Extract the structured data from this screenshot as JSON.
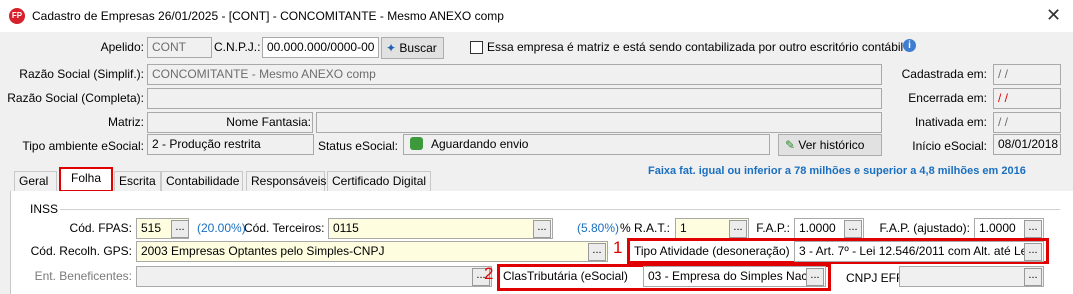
{
  "window": {
    "title": "Cadastro de Empresas  26/01/2025 - [CONT] - CONCOMITANTE - Mesmo ANEXO comp",
    "app_icon_text": "FP",
    "close_glyph": "✕"
  },
  "header": {
    "apelido_label": "Apelido:",
    "apelido_value": "CONT",
    "cnpj_label": "C.N.P.J.:",
    "cnpj_value": "00.000.000/0000-00",
    "buscar_label": "Buscar",
    "matriz_checkbox_label": "Essa empresa é matriz e está sendo contabilizada por outro escritório contábil",
    "razao_simplif_label": "Razão Social (Simplif.):",
    "razao_simplif_value": "CONCOMITANTE - Mesmo ANEXO comp",
    "razao_completa_label": "Razão Social (Completa):",
    "razao_completa_value": "",
    "matriz_label": "Matriz:",
    "matriz_value": "",
    "nome_fantasia_label": "Nome Fantasia:",
    "nome_fantasia_value": "",
    "tipo_ambiente_label": "Tipo ambiente eSocial:",
    "tipo_ambiente_value": "2 - Produção restrita",
    "status_esocial_label": "Status eSocial:",
    "status_esocial_value": "Aguardando envio",
    "ver_historico_label": "Ver histórico",
    "cadastrada_label": "Cadastrada em:",
    "cadastrada_value": "/ /",
    "encerrada_label": "Encerrada em:",
    "encerrada_value": "/ /",
    "inativada_label": "Inativada em:",
    "inativada_value": "/ /",
    "inicio_esocial_label": "Início eSocial:",
    "inicio_esocial_value": "08/01/2018"
  },
  "tabs": [
    {
      "label": "Geral",
      "active": false
    },
    {
      "label": "Folha",
      "active": true
    },
    {
      "label": "Escrita",
      "active": false
    },
    {
      "label": "Contabilidade",
      "active": false
    },
    {
      "label": "Responsáveis",
      "active": false
    },
    {
      "label": "Certificado Digital",
      "active": false
    }
  ],
  "faixa_text": "Faixa fat. igual ou inferior a 78 milhões e superior a 4,8 milhões em 2016",
  "inss": {
    "group_label": "INSS",
    "cod_fpas_label": "Cód. FPAS:",
    "cod_fpas_value": "515",
    "fpas_pct": "(20.00%)",
    "cod_terceiros_label": "Cód. Terceiros:",
    "cod_terceiros_value": "0115",
    "terceiros_pct": "(5.80%)",
    "rat_label": "% R.A.T.:",
    "rat_value": "1",
    "fap_label": "F.A.P.:",
    "fap_value": "1.0000",
    "fap_ajustado_label": "F.A.P. (ajustado):",
    "fap_ajustado_value": "1.0000",
    "cod_recolh_gps_label": "Cód. Recolh. GPS:",
    "cod_recolh_gps_value": "2003 Empresas Optantes pelo Simples-CNPJ",
    "tipo_atividade_label": "Tipo Atividade (desoneração)",
    "tipo_atividade_value": "3 - Art. 7º - Lei 12.546/2011 com Alt. até Le",
    "ent_beneficentes_label": "Ent. Beneficentes:",
    "ent_beneficentes_value": "",
    "clas_tributaria_label": "ClasTributária (eSocial)",
    "clas_tributaria_value": "03 - Empresa do Simples Nac.",
    "cnpj_efr_label": "CNPJ EFR",
    "cnpj_efr_value": "",
    "annotation_1": "1",
    "annotation_2": "2"
  },
  "ellipsis": "..."
}
